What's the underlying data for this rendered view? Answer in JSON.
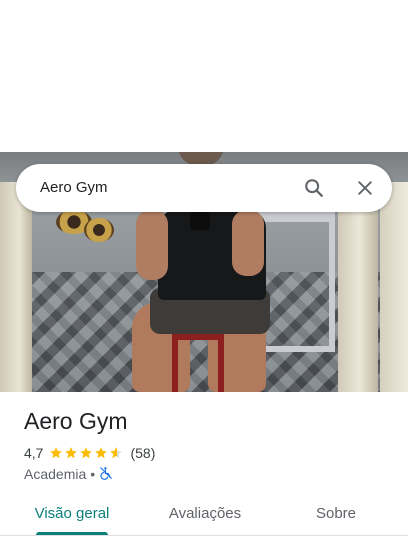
{
  "search": {
    "query": "Aero Gym"
  },
  "icons": {
    "search": "search-icon",
    "close": "close-icon",
    "wheelchair": "wheelchair-not-accessible-icon"
  },
  "place": {
    "name": "Aero Gym",
    "rating": "4,7",
    "rating_value": 4.7,
    "review_count": "(58)",
    "category": "Academia",
    "separator": "•"
  },
  "tabs": [
    {
      "label": "Visão geral",
      "active": true
    },
    {
      "label": "Avaliações",
      "active": false
    },
    {
      "label": "Sobre",
      "active": false
    }
  ],
  "colors": {
    "accent": "#0b7f7a",
    "star": "#fbbc04",
    "star_empty": "#dadce0",
    "accessibility_icon": "#1a73e8"
  }
}
